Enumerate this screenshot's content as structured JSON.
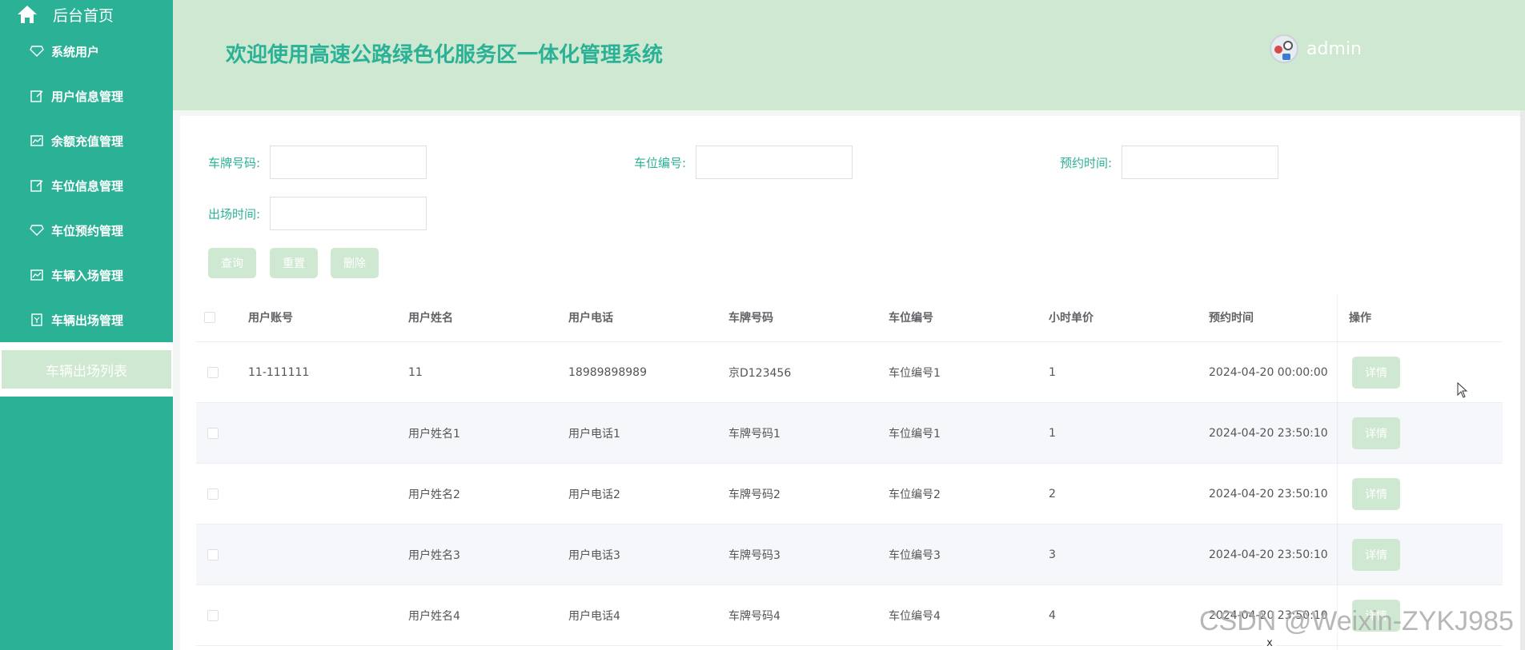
{
  "sidebar": {
    "home_label": "后台首页",
    "items": [
      {
        "label": "系统用户",
        "icon": "diamond-icon"
      },
      {
        "label": "用户信息管理",
        "icon": "edit-icon"
      },
      {
        "label": "余额充值管理",
        "icon": "chart-icon"
      },
      {
        "label": "车位信息管理",
        "icon": "edit-icon"
      },
      {
        "label": "车位预约管理",
        "icon": "diamond-icon"
      },
      {
        "label": "车辆入场管理",
        "icon": "chart-icon"
      },
      {
        "label": "车辆出场管理",
        "icon": "bookmark-icon"
      }
    ],
    "active_sub": "车辆出场列表"
  },
  "header": {
    "title": "欢迎使用高速公路绿色化服务区一体化管理系统",
    "username": "admin"
  },
  "search": {
    "plate_label": "车牌号码:",
    "space_label": "车位编号:",
    "reserve_label": "预约时间:",
    "exit_label": "出场时间:"
  },
  "buttons": {
    "query": "查询",
    "reset": "重置",
    "delete": "删除"
  },
  "table": {
    "headers": [
      "用户账号",
      "用户姓名",
      "用户电话",
      "车牌号码",
      "车位编号",
      "小时单价",
      "预约时间",
      "操作"
    ],
    "detail_label": "详情",
    "rows": [
      [
        "11-111111",
        "11",
        "18989898989",
        "京D123456",
        "车位编号1",
        "1",
        "2024-04-20 00:00:00"
      ],
      [
        "",
        "用户姓名1",
        "用户电话1",
        "车牌号码1",
        "车位编号1",
        "1",
        "2024-04-20 23:50:10"
      ],
      [
        "",
        "用户姓名2",
        "用户电话2",
        "车牌号码2",
        "车位编号2",
        "2",
        "2024-04-20 23:50:10"
      ],
      [
        "",
        "用户姓名3",
        "用户电话3",
        "车牌号码3",
        "车位编号3",
        "3",
        "2024-04-20 23:50:10"
      ],
      [
        "",
        "用户姓名4",
        "用户电话4",
        "车牌号码4",
        "车位编号4",
        "4",
        "2024-04-20 23:50:10"
      ]
    ]
  },
  "watermark": "CSDN @Weixin-ZYKJ985",
  "close_label": "x",
  "colors": {
    "primary": "#2bb196",
    "light": "#cfe8d1"
  }
}
